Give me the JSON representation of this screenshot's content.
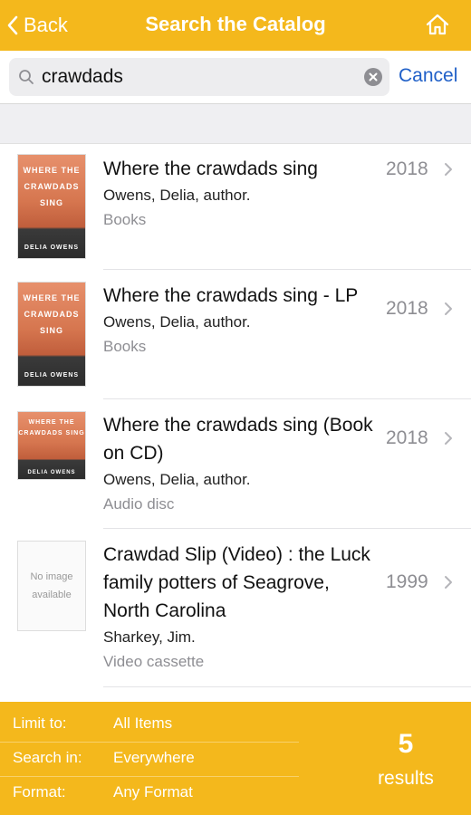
{
  "nav": {
    "back_label": "Back",
    "title": "Search the Catalog",
    "home_icon": "home-icon"
  },
  "search": {
    "value": "crawdads",
    "cancel_label": "Cancel"
  },
  "results": [
    {
      "title": "Where the crawdads sing",
      "author": "Owens, Delia, author.",
      "format": "Books",
      "year": "2018",
      "cover": {
        "title": "WHERE THE CRAWDADS SING",
        "author": "DELIA OWENS"
      }
    },
    {
      "title": "Where the crawdads sing - LP",
      "author": "Owens, Delia, author.",
      "format": "Books",
      "year": "2018",
      "cover": {
        "title": "WHERE THE CRAWDADS SING",
        "author": "DELIA OWENS"
      }
    },
    {
      "title": "Where the crawdads sing (Book on CD)",
      "author": "Owens, Delia, author.",
      "format": "Audio disc",
      "year": "2018",
      "cover": {
        "title": "WHERE THE CRAWDADS SING",
        "author": "DELIA OWENS"
      }
    },
    {
      "title": "Crawdad Slip (Video) : the Luck family potters of Seagrove, North Carolina",
      "author": "Sharkey, Jim.",
      "format": "Video cassette",
      "year": "1999",
      "no_image_text": "No image available"
    }
  ],
  "footer": {
    "limit_label": "Limit to:",
    "limit_value": "All Items",
    "search_in_label": "Search in:",
    "search_in_value": "Everywhere",
    "format_label": "Format:",
    "format_value": "Any Format",
    "count": "5",
    "results_label": "results"
  },
  "colors": {
    "accent": "#F4B81C",
    "link": "#2060C8",
    "secondary_text": "#8e8e93"
  }
}
